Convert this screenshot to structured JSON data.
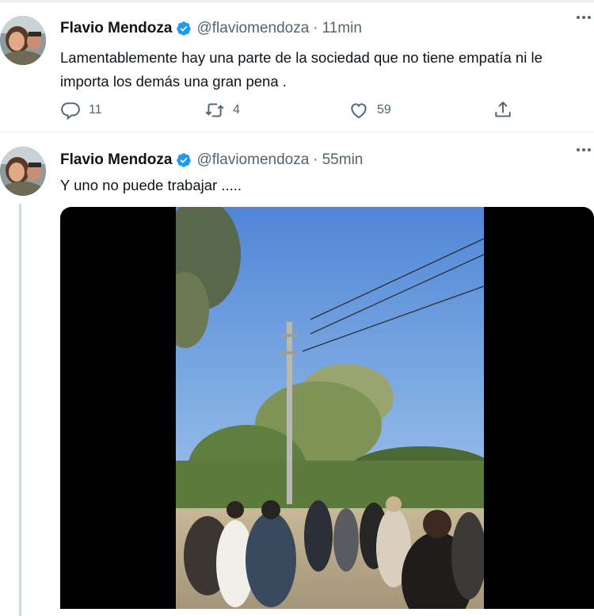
{
  "tweets": [
    {
      "author": "Flavio Mendoza",
      "handle": "@flaviomendoza",
      "separator": "·",
      "time": "11min",
      "text": "Lamentablemente hay una parte de la sociedad que no tiene empatía ni le importa los demás una gran pena .",
      "replies": "11",
      "retweets": "4",
      "likes": "59"
    },
    {
      "author": "Flavio Mendoza",
      "handle": "@flaviomendoza",
      "separator": "·",
      "time": "55min",
      "text": "Y uno no puede trabajar .....",
      "media_type": "video"
    }
  ],
  "colors": {
    "verified": "#1d9bf0",
    "muted": "#536471",
    "text": "#0f1419",
    "divider": "#e6ecf0"
  },
  "icons": [
    "verified-badge-icon",
    "more-icon",
    "reply-icon",
    "retweet-icon",
    "like-icon",
    "share-icon"
  ]
}
